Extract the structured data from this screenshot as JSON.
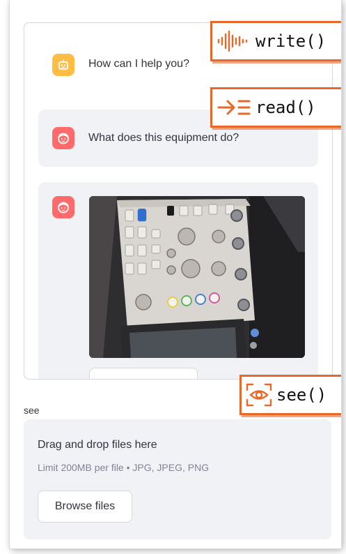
{
  "chat": {
    "messages": [
      {
        "role": "assistant",
        "text": "How can I help you?"
      },
      {
        "role": "user",
        "text": "What does this equipment do?"
      },
      {
        "role": "user",
        "attachment": "oscilloscope-photo"
      }
    ]
  },
  "uploader": {
    "label": "see",
    "title": "Drag and drop files here",
    "hint": "Limit 200MB per file • JPG, JPEG, PNG",
    "browse_label": "Browse files"
  },
  "callouts": {
    "write": "write()",
    "read": "read()",
    "see": "see()"
  },
  "icons": {
    "assistant_avatar": "robot-icon",
    "user_avatar": "face-icon",
    "write_callout": "sound-wave-icon",
    "read_callout": "arrow-lines-icon",
    "see_callout": "eye-icon"
  },
  "colors": {
    "accent": "#e8682a",
    "assistant_avatar": "#ffbd45",
    "user_avatar": "#ff6b6b",
    "message_bg": "#f1f2f6",
    "dropzone_bg": "#f0f2f6"
  }
}
